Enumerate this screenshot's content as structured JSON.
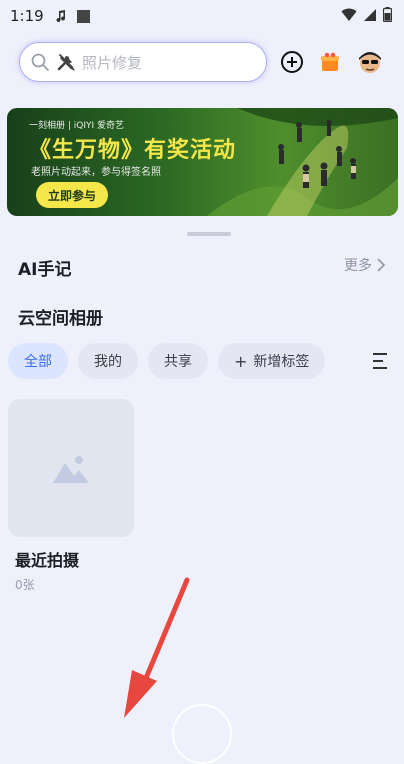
{
  "status_bar": {
    "time": "1:19"
  },
  "search": {
    "placeholder": "照片修复"
  },
  "banner": {
    "brand_text": "一刻相册 | iQIYI 爱奇艺",
    "title": "《生万物》有奖活动",
    "subtitle": "老照片动起来，参与得签名照",
    "cta_label": "立即参与"
  },
  "ai_notes": {
    "title": "AI手记",
    "more_label": "更多"
  },
  "cloud_album": {
    "title": "云空间相册"
  },
  "filter_chips": [
    {
      "label": "全部",
      "active": true
    },
    {
      "label": "我的",
      "active": false
    },
    {
      "label": "共享",
      "active": false
    },
    {
      "label": "新增标签",
      "active": false
    }
  ],
  "albums": [
    {
      "name": "最近拍摄",
      "count": "0张"
    }
  ],
  "colors": {
    "accent": "#3b6df0",
    "banner_title": "#f5e64a",
    "arrow": "#e8473d"
  }
}
